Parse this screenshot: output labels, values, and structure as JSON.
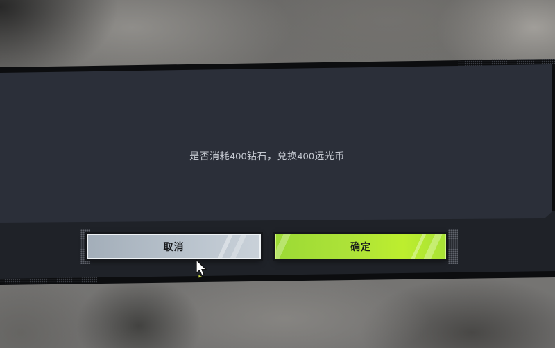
{
  "dialog": {
    "message": "是否消耗400钻石，兑换400远光币",
    "cancel_label": "取消",
    "confirm_label": "确定"
  },
  "colors": {
    "panel": "#2b2f39",
    "panel_lower": "#1f2228",
    "band_border": "#0c0d0f",
    "message_text": "#c5c9d1",
    "cancel_bg": "#b8c2cc",
    "confirm_bg": "#aee338",
    "button_text": "#16181b"
  },
  "cursor": {
    "icon": "mouse-pointer-icon"
  }
}
